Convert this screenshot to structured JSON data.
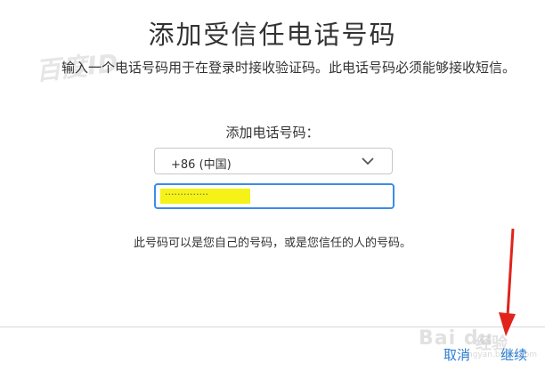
{
  "watermark": {
    "top_text": "百度ID",
    "brand": "Bai du",
    "jingyan": "经验",
    "url": "jingyan.baidu.com"
  },
  "dialog": {
    "title": "添加受信任电话号码",
    "description": "输入一个电话号码用于在登录时接收验证码。此电话号码必须能够接收短信。",
    "phone_label": "添加电话号码：",
    "country_select": {
      "value": "+86 (中国)",
      "icon": "chevron-down-icon"
    },
    "phone_input": {
      "value": "··············"
    },
    "note": "此号码可以是您自己的号码，或是您信任的人的号码。"
  },
  "footer": {
    "cancel_label": "取消",
    "continue_label": "继续"
  },
  "colors": {
    "link": "#2b7cd3",
    "focus_border": "#3b8ce8",
    "highlight": "#f4f217",
    "annotation_arrow": "#e0241b"
  }
}
